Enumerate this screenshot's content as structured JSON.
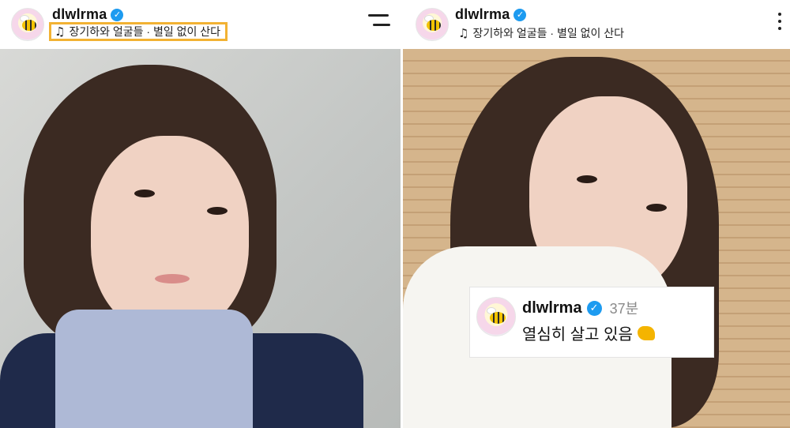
{
  "left_post": {
    "username": "dlwlrma",
    "verified_icon": "verified-badge-icon",
    "music_icon": "music-note-icon",
    "music_text": "장기하와 얼굴들 · 별일 없이 산다",
    "highlight_color": "#f2b233"
  },
  "right_post": {
    "username": "dlwlrma",
    "verified_icon": "verified-badge-icon",
    "music_icon": "music-note-icon",
    "music_text": "장기하와 얼굴들 · 별일 없이 산다",
    "more_icon": "more-options-icon"
  },
  "divider": {
    "icon": "equals-menu-icon"
  },
  "comment": {
    "username": "dlwlrma",
    "time": "37분",
    "text": "열심히 살고 있음",
    "emoji_icon": "flexed-biceps-icon"
  },
  "colors": {
    "verified_blue": "#1d9bf0",
    "accent_yellow": "#f2b233"
  }
}
